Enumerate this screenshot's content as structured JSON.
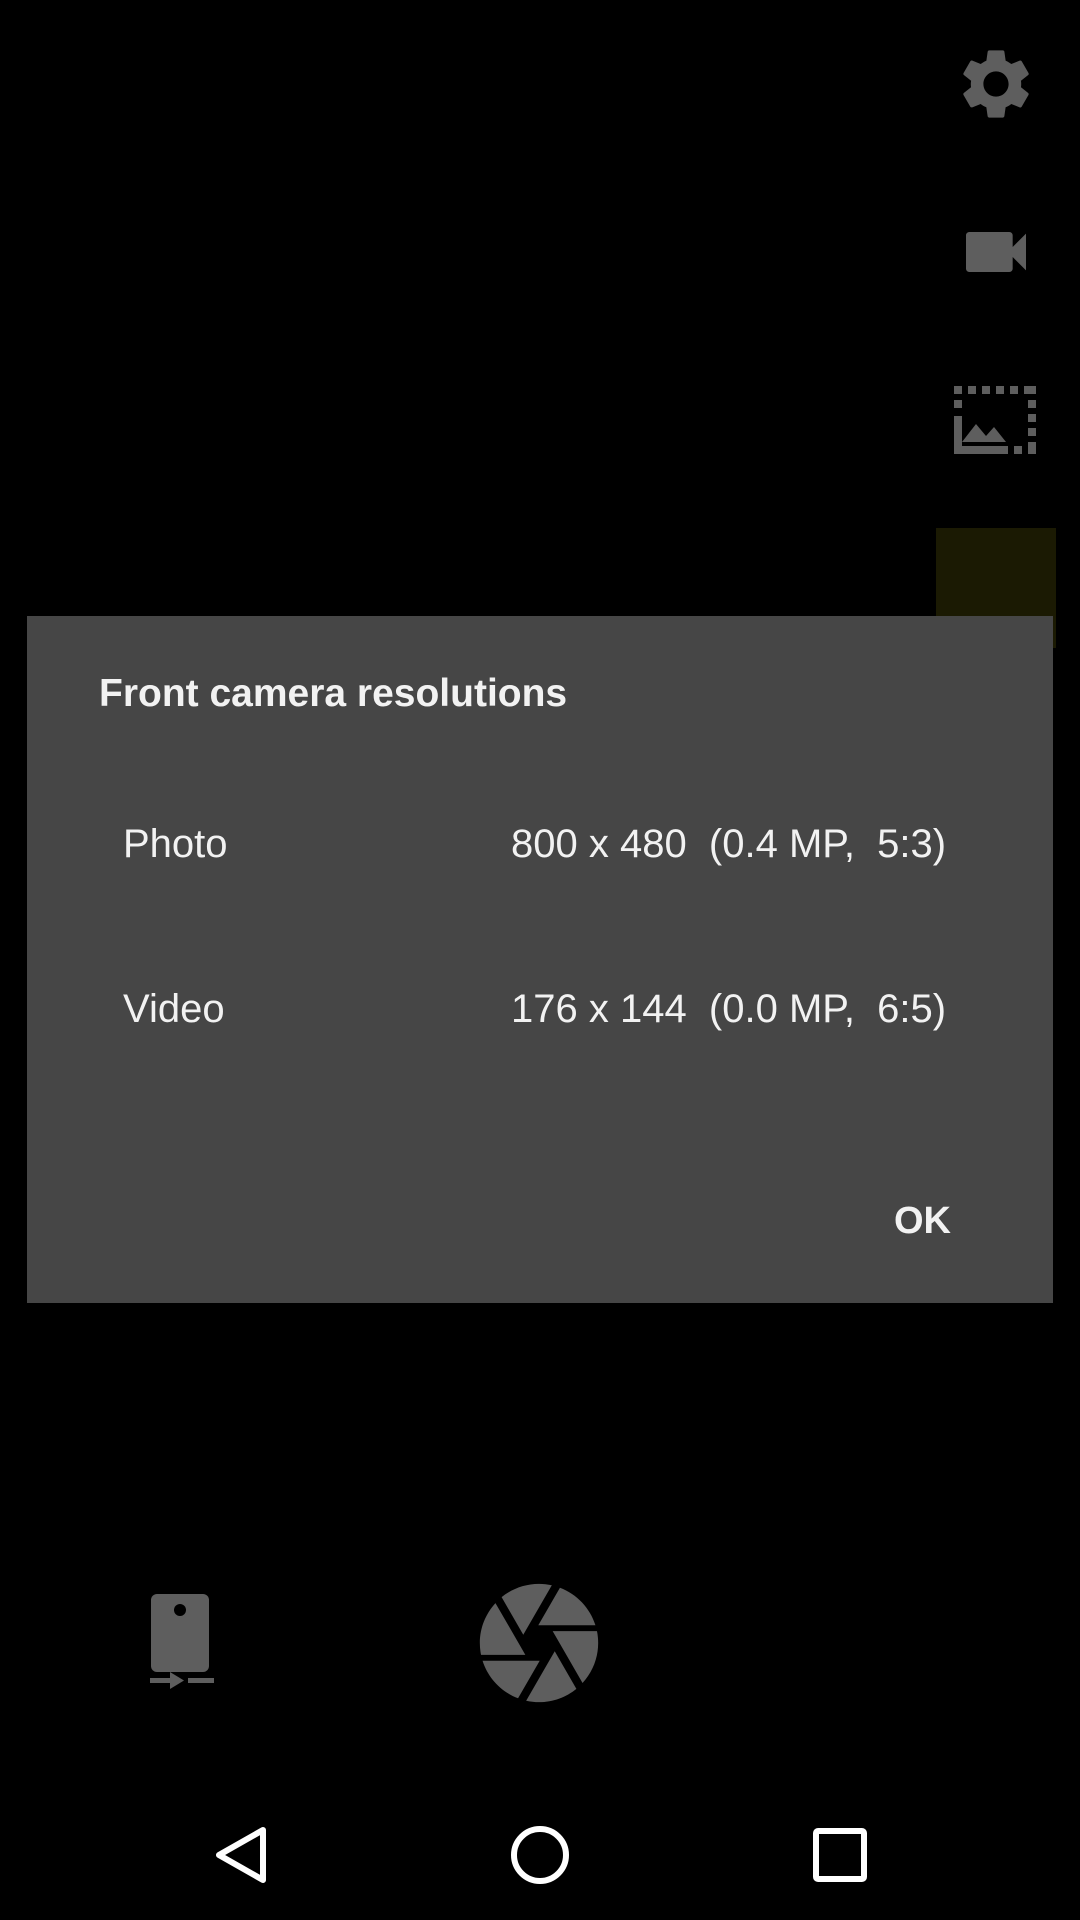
{
  "colors": {
    "background": "#000000",
    "dialog_background": "#464646",
    "text": "#f2f2f2",
    "icon_gray": "#5e5e5e"
  },
  "top_controls": {
    "icons": [
      "gear-icon",
      "videocam-icon",
      "photo-resolution-icon"
    ]
  },
  "dialog": {
    "title": "Front camera resolutions",
    "rows": [
      {
        "label": "Photo",
        "value": "800 x 480  (0.4 MP,  5:3)"
      },
      {
        "label": "Video",
        "value": "176 x 144  (0.0 MP,  6:5)"
      }
    ],
    "ok_label": "OK"
  },
  "bottom_controls": {
    "icons": [
      "switch-camera-icon",
      "shutter-icon"
    ]
  },
  "navbar": {
    "icons": [
      "back-icon",
      "home-icon",
      "recents-icon"
    ]
  }
}
